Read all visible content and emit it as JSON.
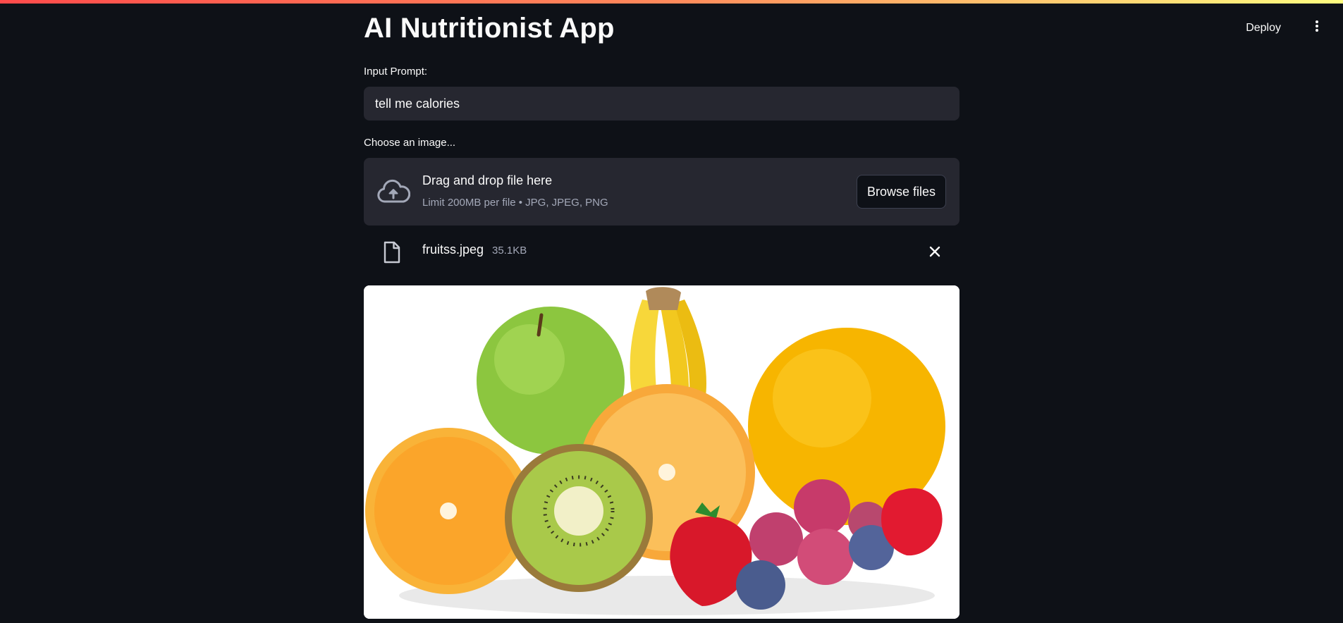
{
  "app": {
    "title": "AI Nutritionist App"
  },
  "header": {
    "deploy_label": "Deploy",
    "menu_icon": "more-vertical-icon"
  },
  "prompt": {
    "label": "Input Prompt:",
    "value": "tell me calories"
  },
  "uploader": {
    "label": "Choose an image...",
    "drop_title": "Drag and drop file here",
    "drop_subtitle": "Limit 200MB per file • JPG, JPEG, PNG",
    "browse_label": "Browse files",
    "icon": "cloud-upload-icon"
  },
  "uploaded_file": {
    "name": "fruitss.jpeg",
    "size": "35.1KB",
    "icon": "file-icon",
    "remove_icon": "close-icon"
  },
  "preview_image": {
    "alt_subject": "fruits"
  },
  "colors": {
    "background": "#0e1117",
    "surface": "#262730",
    "text": "#fafafa",
    "muted_text": "#a3a8b8",
    "accent_start": "#ff4b4b",
    "accent_end": "#fffd80"
  }
}
